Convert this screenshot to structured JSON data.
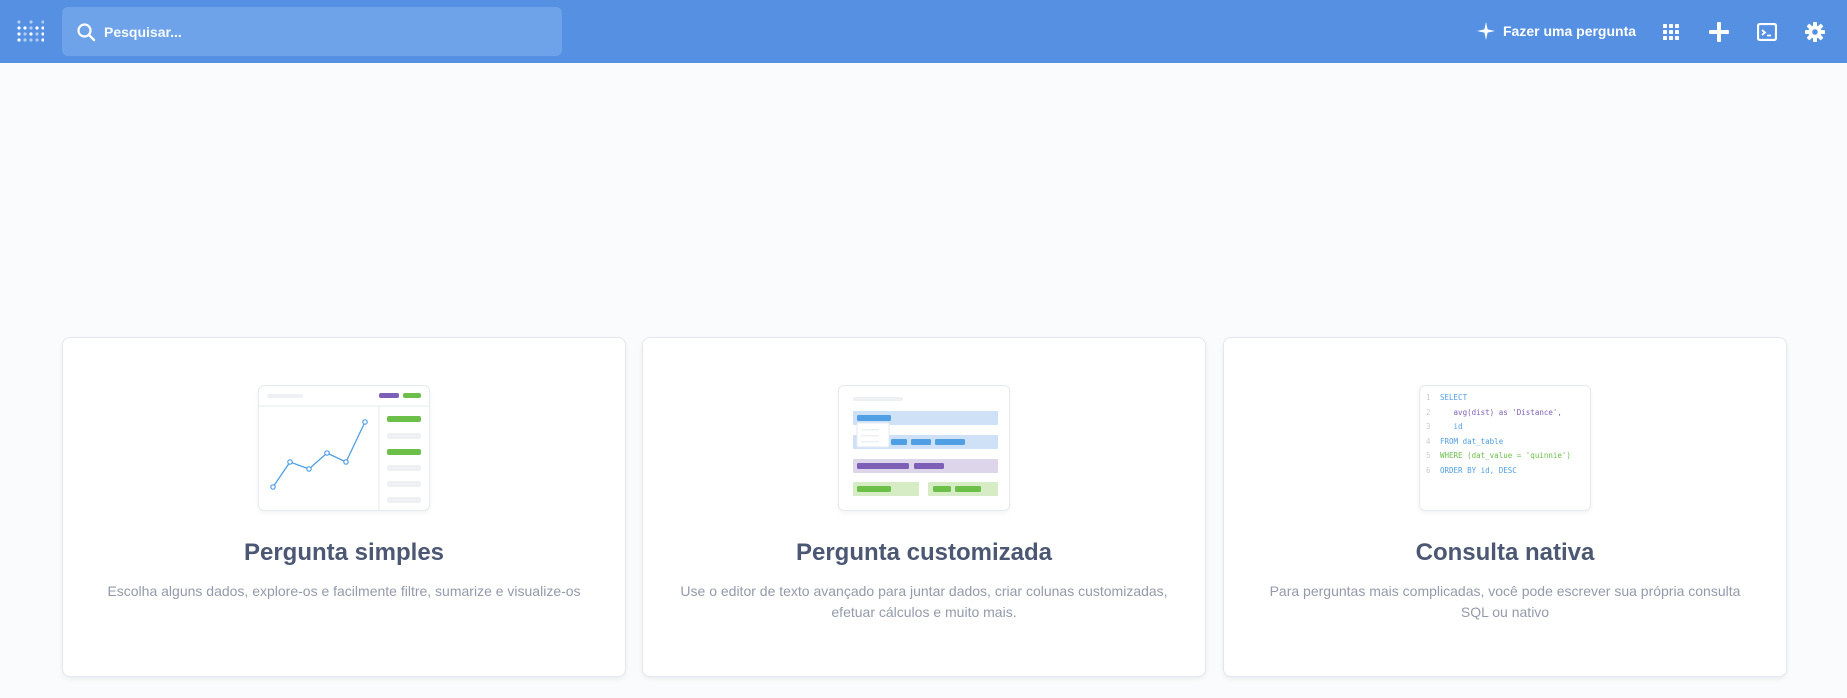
{
  "colors": {
    "topbar": "#5590e3",
    "search_bg": "#6ea3e9",
    "page_bg": "#f9fbfc",
    "brand_blue": "#509ee3",
    "purple": "#7e5fb8",
    "green": "#84bb4c",
    "title": "#4c5773",
    "muted": "#949aab"
  },
  "topbar": {
    "logo_icon": "metabase-logo-icon",
    "search": {
      "icon": "search-icon",
      "placeholder": "Pesquisar..."
    },
    "ask_question": {
      "icon": "sparkle-icon",
      "label": "Fazer uma pergunta"
    },
    "icons": [
      "grid-icon",
      "plus-icon",
      "sql-editor-icon",
      "gear-icon"
    ]
  },
  "cards": [
    {
      "title": "Pergunta simples",
      "description": "Escolha alguns dados, explore-os e facilmente filtre, sumarize e visualize-os",
      "illustration": "line-chart-illustration"
    },
    {
      "title": "Pergunta customizada",
      "description": "Use o editor de texto avançado para juntar dados, criar colunas customizadas, efetuar cálculos e muito mais.",
      "illustration": "notebook-editor-illustration"
    },
    {
      "title": "Consulta nativa",
      "description": "Para perguntas mais complicadas, você pode escrever sua própria consulta SQL ou nativo",
      "illustration": "sql-code-illustration",
      "code_lines": [
        {
          "n": "1",
          "text": "SELECT"
        },
        {
          "n": "2",
          "text": "   avg(dist) as 'Distance',"
        },
        {
          "n": "3",
          "text": "   id"
        },
        {
          "n": "4",
          "text": "FROM dat_table"
        },
        {
          "n": "5",
          "text": "WHERE (dat_value = 'quinnie')"
        },
        {
          "n": "6",
          "text": "ORDER BY id, DESC"
        }
      ]
    }
  ]
}
